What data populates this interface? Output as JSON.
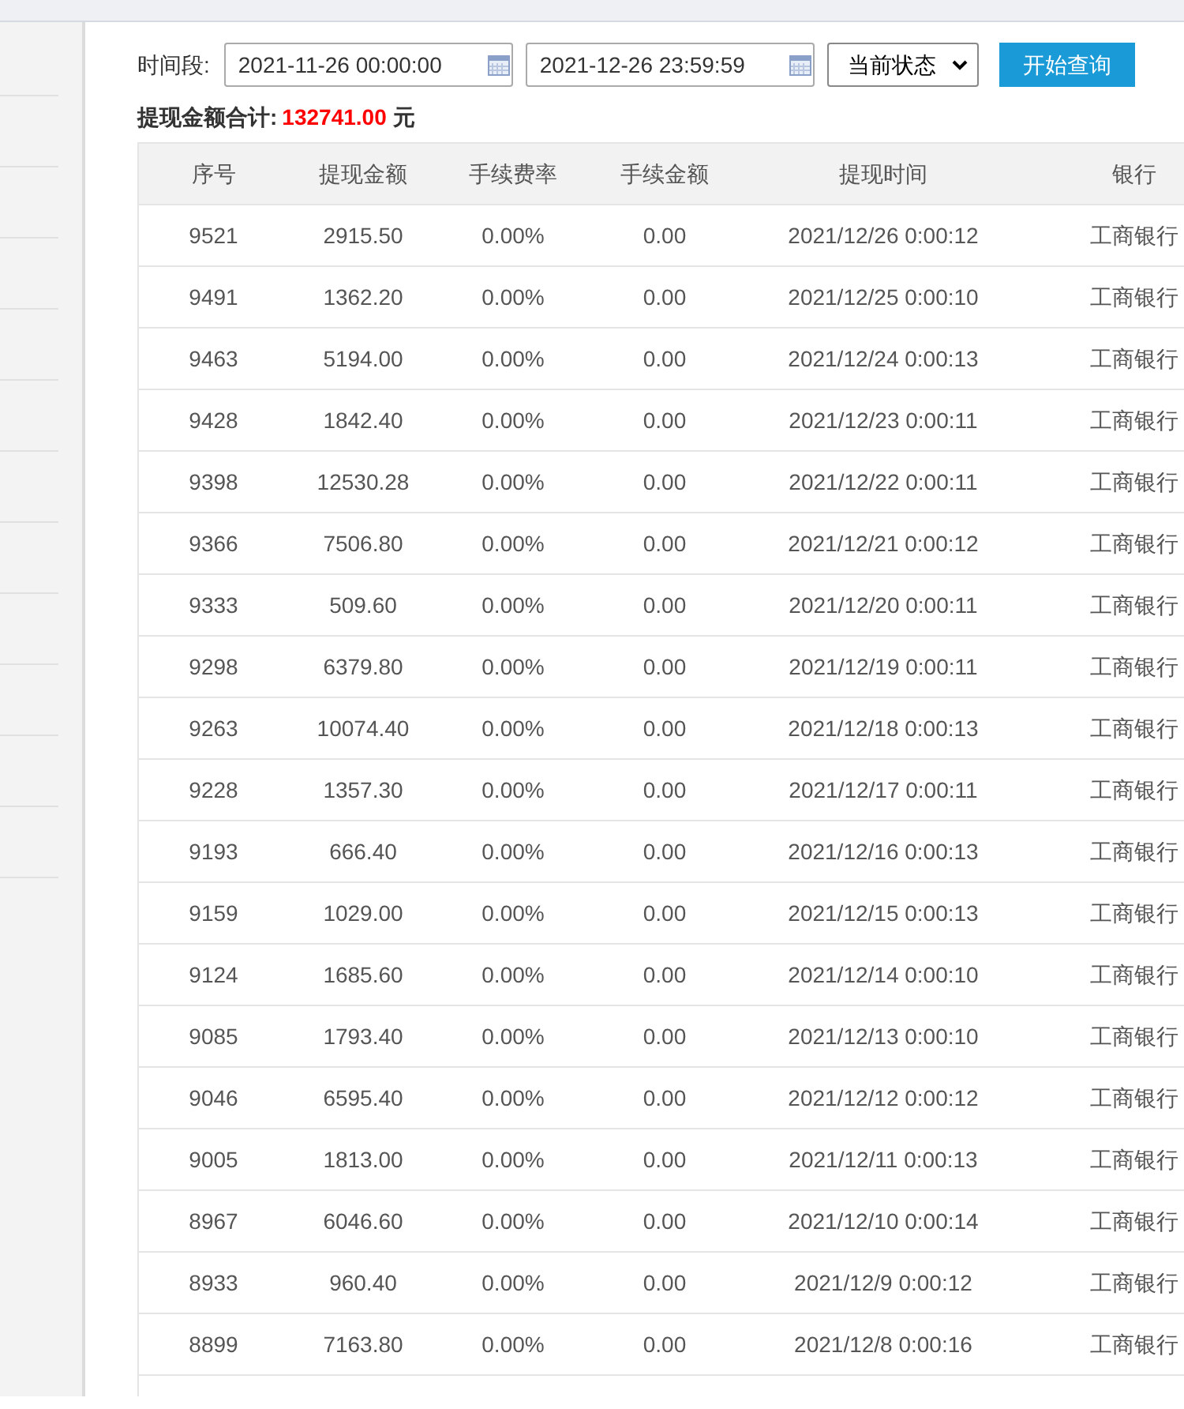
{
  "filter": {
    "label": "时间段:",
    "start": "2021-11-26 00:00:00",
    "end": "2021-12-26 23:59:59",
    "status_select": "当前状态",
    "query_button": "开始查询"
  },
  "total": {
    "label": "提现金额合计:",
    "amount": "132741.00",
    "unit": "元"
  },
  "table": {
    "columns": [
      "序号",
      "提现金额",
      "手续费率",
      "手续金额",
      "提现时间",
      "银行"
    ],
    "rows": [
      [
        "9521",
        "2915.50",
        "0.00%",
        "0.00",
        "2021/12/26 0:00:12",
        "工商银行"
      ],
      [
        "9491",
        "1362.20",
        "0.00%",
        "0.00",
        "2021/12/25 0:00:10",
        "工商银行"
      ],
      [
        "9463",
        "5194.00",
        "0.00%",
        "0.00",
        "2021/12/24 0:00:13",
        "工商银行"
      ],
      [
        "9428",
        "1842.40",
        "0.00%",
        "0.00",
        "2021/12/23 0:00:11",
        "工商银行"
      ],
      [
        "9398",
        "12530.28",
        "0.00%",
        "0.00",
        "2021/12/22 0:00:11",
        "工商银行"
      ],
      [
        "9366",
        "7506.80",
        "0.00%",
        "0.00",
        "2021/12/21 0:00:12",
        "工商银行"
      ],
      [
        "9333",
        "509.60",
        "0.00%",
        "0.00",
        "2021/12/20 0:00:11",
        "工商银行"
      ],
      [
        "9298",
        "6379.80",
        "0.00%",
        "0.00",
        "2021/12/19 0:00:11",
        "工商银行"
      ],
      [
        "9263",
        "10074.40",
        "0.00%",
        "0.00",
        "2021/12/18 0:00:13",
        "工商银行"
      ],
      [
        "9228",
        "1357.30",
        "0.00%",
        "0.00",
        "2021/12/17 0:00:11",
        "工商银行"
      ],
      [
        "9193",
        "666.40",
        "0.00%",
        "0.00",
        "2021/12/16 0:00:13",
        "工商银行"
      ],
      [
        "9159",
        "1029.00",
        "0.00%",
        "0.00",
        "2021/12/15 0:00:13",
        "工商银行"
      ],
      [
        "9124",
        "1685.60",
        "0.00%",
        "0.00",
        "2021/12/14 0:00:10",
        "工商银行"
      ],
      [
        "9085",
        "1793.40",
        "0.00%",
        "0.00",
        "2021/12/13 0:00:10",
        "工商银行"
      ],
      [
        "9046",
        "6595.40",
        "0.00%",
        "0.00",
        "2021/12/12 0:00:12",
        "工商银行"
      ],
      [
        "9005",
        "1813.00",
        "0.00%",
        "0.00",
        "2021/12/11 0:00:13",
        "工商银行"
      ],
      [
        "8967",
        "6046.60",
        "0.00%",
        "0.00",
        "2021/12/10 0:00:14",
        "工商银行"
      ],
      [
        "8933",
        "960.40",
        "0.00%",
        "0.00",
        "2021/12/9 0:00:12",
        "工商银行"
      ],
      [
        "8899",
        "7163.80",
        "0.00%",
        "0.00",
        "2021/12/8 0:00:16",
        "工商银行"
      ]
    ]
  }
}
